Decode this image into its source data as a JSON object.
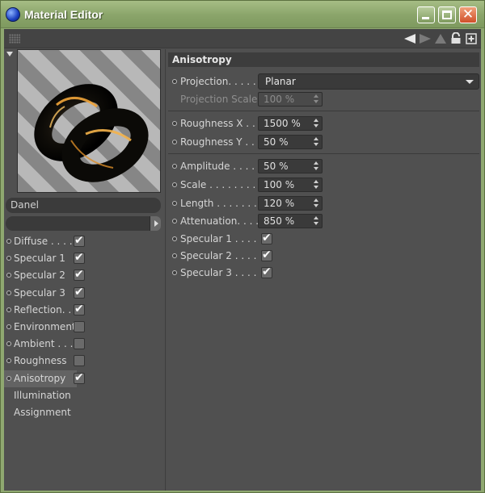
{
  "window": {
    "title": "Material Editor",
    "accent": "#8fa870"
  },
  "left_panel": {
    "material_name": "Danel",
    "channels": [
      {
        "label": "Diffuse . . . .",
        "checkbox": true,
        "checked": true,
        "bullet": true,
        "selected": false
      },
      {
        "label": "Specular 1",
        "checkbox": true,
        "checked": true,
        "bullet": true,
        "selected": false
      },
      {
        "label": "Specular 2",
        "checkbox": true,
        "checked": true,
        "bullet": true,
        "selected": false
      },
      {
        "label": "Specular 3",
        "checkbox": true,
        "checked": true,
        "bullet": true,
        "selected": false
      },
      {
        "label": "Reflection. .",
        "checkbox": true,
        "checked": true,
        "bullet": true,
        "selected": false
      },
      {
        "label": "Environment",
        "checkbox": true,
        "checked": false,
        "bullet": true,
        "selected": false
      },
      {
        "label": "Ambient . . .",
        "checkbox": true,
        "checked": false,
        "bullet": true,
        "selected": false
      },
      {
        "label": "Roughness",
        "checkbox": true,
        "checked": false,
        "bullet": true,
        "selected": false
      },
      {
        "label": "Anisotropy",
        "checkbox": true,
        "checked": true,
        "bullet": true,
        "selected": true
      },
      {
        "label": "Illumination",
        "checkbox": false,
        "checked": false,
        "bullet": false,
        "selected": false
      },
      {
        "label": "Assignment",
        "checkbox": false,
        "checked": false,
        "bullet": false,
        "selected": false
      }
    ]
  },
  "section": {
    "title": "Anisotropy",
    "projection": {
      "label": "Projection. . . . .",
      "value": "Planar"
    },
    "projection_scale": {
      "label": "Projection Scale",
      "value": "100 %"
    },
    "roughness_x": {
      "label": "Roughness X . .",
      "value": "1500 %"
    },
    "roughness_y": {
      "label": "Roughness Y . .",
      "value": "50 %"
    },
    "amplitude": {
      "label": "Amplitude . . . . .",
      "value": "50 %"
    },
    "scale": {
      "label": "Scale . . . . . . . .",
      "value": "100 %"
    },
    "length": {
      "label": "Length . . . . . . .",
      "value": "120 %"
    },
    "attenuation": {
      "label": "Attenuation. . . .",
      "value": "850 %"
    },
    "specular_1": {
      "label": "Specular 1 . . . .",
      "checked": true
    },
    "specular_2": {
      "label": "Specular 2 . . . .",
      "checked": true
    },
    "specular_3": {
      "label": "Specular 3 . . . .",
      "checked": true
    }
  }
}
